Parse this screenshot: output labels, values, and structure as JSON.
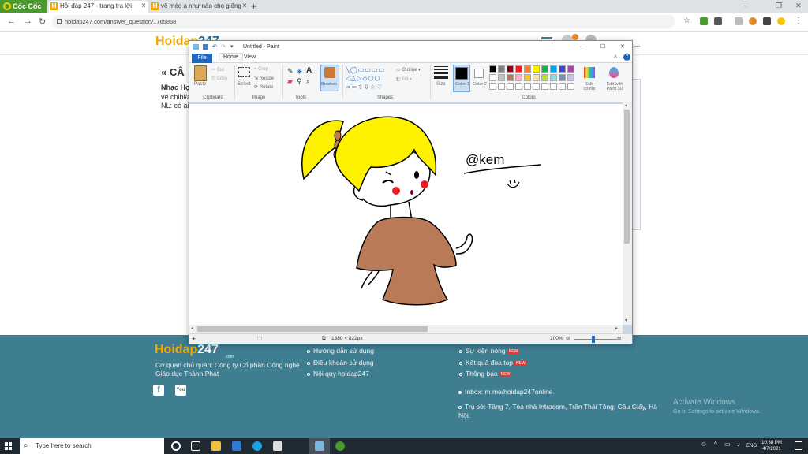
{
  "browser": {
    "logo": "Cốc Cốc",
    "tabs": [
      {
        "title": "Hỏi đáp 247 - trang tra lời"
      },
      {
        "title": "vẽ méo a như nào cho giống"
      }
    ],
    "url": "hoidap247.com/answer_question/1765868"
  },
  "site": {
    "logo_main": "Hoidap",
    "logo_num": "247",
    "question_prefix": "« CÂ",
    "line1": "Nhạc Họ",
    "line2": "vẽ chibi/a",
    "line3": "NL: có ai c",
    "side_text": "it ..."
  },
  "paint": {
    "title": "Untitled - Paint",
    "tabs": {
      "file": "File",
      "home": "Home",
      "view": "View"
    },
    "clipboard": {
      "paste": "Paste",
      "cut": "Cut",
      "copy": "Copy",
      "label": "Clipboard"
    },
    "image": {
      "select": "Select",
      "crop": "Crop",
      "resize": "Resize",
      "rotate": "Rotate",
      "label": "Image"
    },
    "tools_label": "Tools",
    "brushes": "Brushes",
    "shapes": {
      "outline": "Outline",
      "fill": "Fill",
      "label": "Shapes"
    },
    "size": "Size",
    "color1": "Color 1",
    "color2": "Color 2",
    "edit_colors": "Edit colors",
    "edit_paint3d": "Edit with Paint 3D",
    "colors_label": "Colors",
    "palette": [
      "#000000",
      "#7f7f7f",
      "#880015",
      "#ed1c24",
      "#ff7f27",
      "#fff200",
      "#22b14c",
      "#00a2e8",
      "#3f48cc",
      "#a349a4",
      "#ffffff",
      "#c3c3c3",
      "#b97a57",
      "#ffaec9",
      "#ffc90e",
      "#efe4b0",
      "#b5e61d",
      "#99d9ea",
      "#7092be",
      "#c8bfe7"
    ],
    "drawing": {
      "signature": "@kem"
    },
    "status": {
      "dimensions": "1880 × 822px",
      "zoom": "100%"
    }
  },
  "footer": {
    "logo_main": "Hoidap",
    "logo_num": "247",
    "logo_sub": ".com",
    "company1": "Cơ quan chủ quản: Công ty Cổ phần Công nghệ",
    "company2": "Giáo dục Thành Phát",
    "links_col1": [
      "Hướng dẫn sử dụng",
      "Điều khoản sử dụng",
      "Nội quy hoidap247"
    ],
    "links_col2": [
      "Sự kiện nóng",
      "Kết quả đua top",
      "Thông báo"
    ],
    "new_badge": "NEW",
    "inbox": "Inbox: m.me/hoidap247online",
    "address1": "Trụ sở: Tầng 7, Tòa nhà Intracom, Trần Thái Tông, Cầu Giấy, Hà",
    "address2": "Nội.",
    "activate_title": "Activate Windows",
    "activate_sub": "Go to Settings to activate Windows."
  },
  "taskbar": {
    "search_placeholder": "Type here to search",
    "lang": "ENG",
    "time": "10:38 PM",
    "date": "4/7/2021"
  }
}
